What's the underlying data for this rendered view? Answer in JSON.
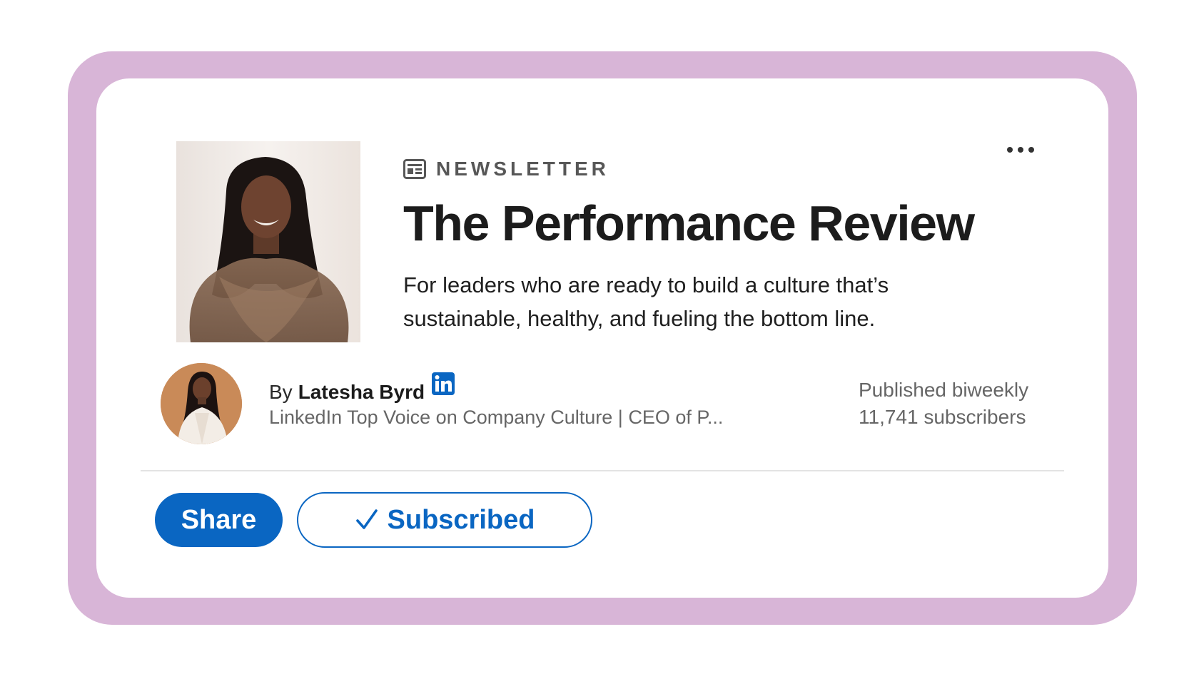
{
  "newsletter": {
    "kicker": "NEWSLETTER",
    "kicker_icon": "newspaper-icon",
    "title": "The Performance Review",
    "description": "For leaders who are ready to build a culture that’s sustainable, healthy, and fueling the bottom line."
  },
  "author": {
    "byline_prefix": "By",
    "name": "Latesha Byrd",
    "badge_icon": "linkedin-icon",
    "headline": "LinkedIn Top Voice on Company Culture | CEO of P..."
  },
  "meta": {
    "frequency": "Published biweekly",
    "subscribers": "11,741 subscribers"
  },
  "actions": {
    "share_label": "Share",
    "subscribed_label": "Subscribed",
    "subscribed_icon": "checkmark-icon",
    "more_icon": "more-options-icon"
  },
  "colors": {
    "frame": "#d8b5d7",
    "brand_blue": "#0a66c2",
    "card": "#ffffff"
  }
}
